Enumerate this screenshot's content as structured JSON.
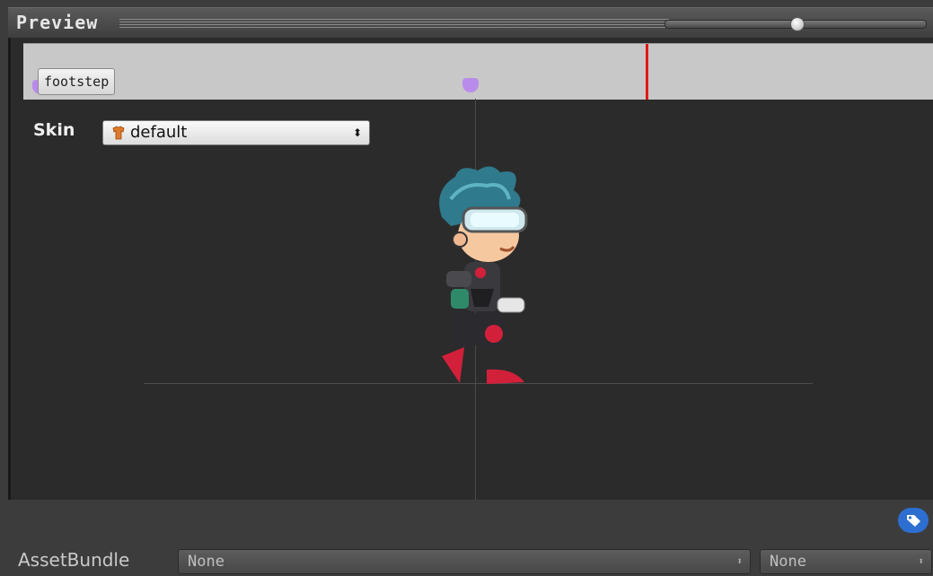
{
  "header": {
    "title": "Preview"
  },
  "timeline": {
    "event_label": "footstep"
  },
  "skin": {
    "label": "Skin",
    "value": "default"
  },
  "footer": {
    "assetbundle_label": "AssetBundle",
    "bundle_name": "None",
    "bundle_variant": "None"
  },
  "colors": {
    "playhead": "#e01818",
    "marker": "#b98bea",
    "tag_badge": "#2d6fd1"
  },
  "icons": [
    "skin-icon",
    "tag-icon",
    "dropdown-arrows-icon"
  ]
}
